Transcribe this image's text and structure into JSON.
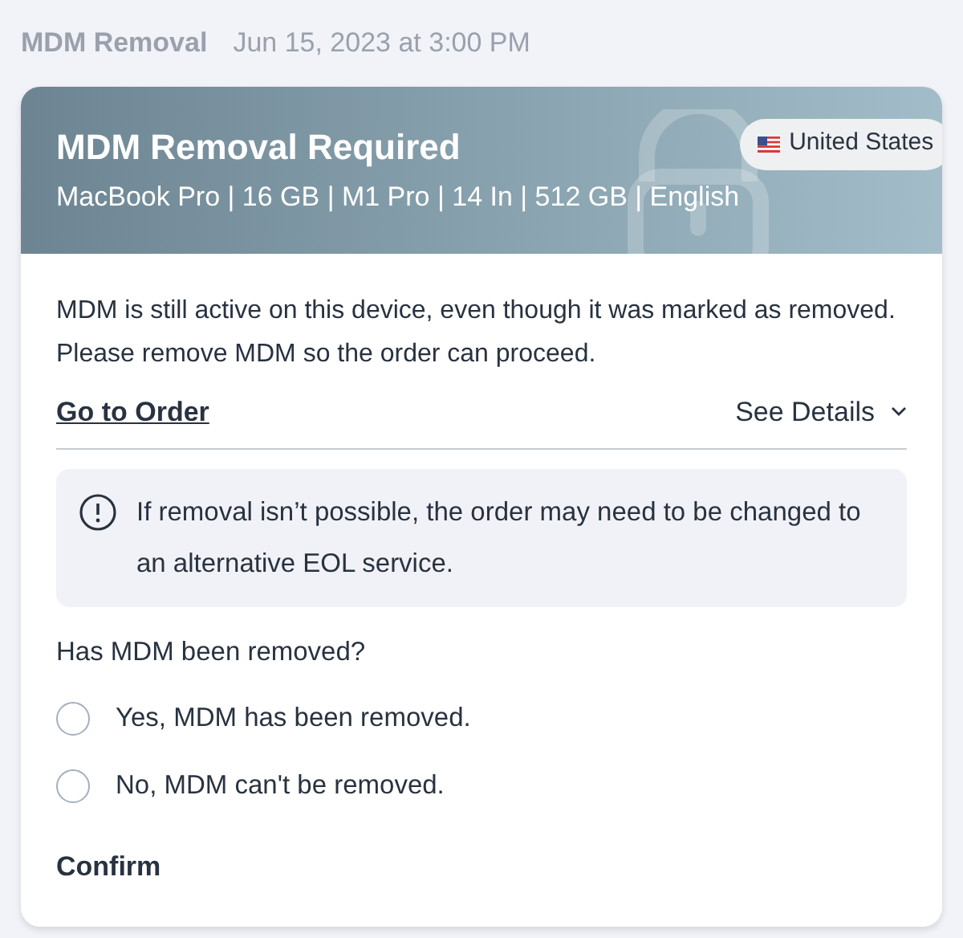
{
  "header": {
    "category": "MDM Removal",
    "timestamp": "Jun 15, 2023 at 3:00 PM"
  },
  "banner": {
    "title": "MDM Removal Required",
    "specs": "MacBook Pro | 16 GB | M1 Pro | 14 In | 512 GB | English",
    "region": "United States"
  },
  "message": "MDM is still active on this device, even though it was marked as removed. Please remove MDM so the order can proceed.",
  "links": {
    "order": "Go to Order",
    "details": "See Details",
    "details_expanded": false
  },
  "notice": "If removal isn’t possible, the order may need to be changed to an alternative EOL service.",
  "question": "Has MDM been removed?",
  "options": [
    {
      "label": "Yes, MDM has been removed.",
      "selected": false
    },
    {
      "label": "No, MDM can't be removed.",
      "selected": false
    }
  ],
  "confirm": "Confirm"
}
